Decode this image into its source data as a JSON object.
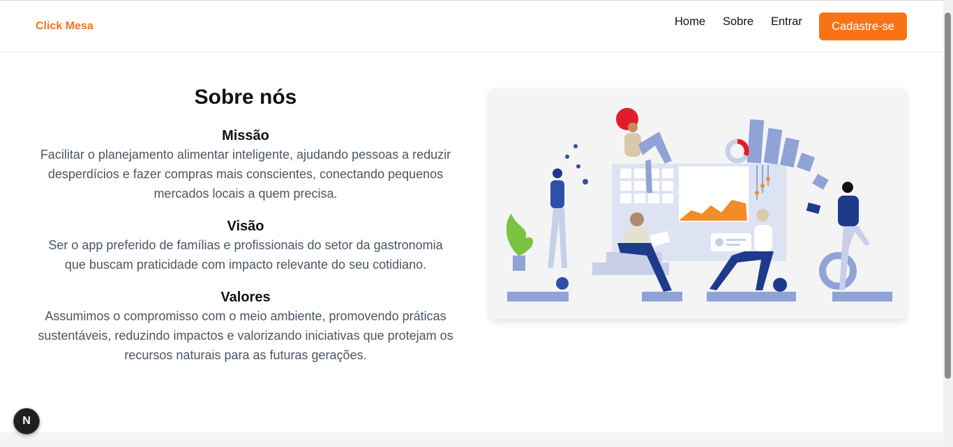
{
  "header": {
    "brand": "Click Mesa",
    "nav": [
      {
        "label": "Home"
      },
      {
        "label": "Sobre"
      },
      {
        "label": "Entrar"
      }
    ],
    "cta_label": "Cadastre-se"
  },
  "main": {
    "title": "Sobre nós",
    "sections": [
      {
        "heading": "Missão",
        "text": "Facilitar o planejamento alimentar inteligente, ajudando pessoas a reduzir desperdícios e fazer compras mais conscientes, conectando pequenos mercados locais a quem precisa."
      },
      {
        "heading": "Visão",
        "text": "Ser o app preferido de famílias e profissionais do setor da gastronomia que buscam praticidade com impacto relevante do seu cotidiano."
      },
      {
        "heading": "Valores",
        "text": "Assumimos o compromisso com o meio ambiente, promovendo práticas sustentáveis, reduzindo impactos e valorizando iniciativas que protejam os recursos naturais para as futuras gerações."
      }
    ]
  },
  "dev_badge": "N",
  "colors": {
    "accent": "#f97316",
    "illustration_blue": "#8fa3d6",
    "illustration_navy": "#1e3a8a",
    "illustration_red": "#e11d2a"
  }
}
